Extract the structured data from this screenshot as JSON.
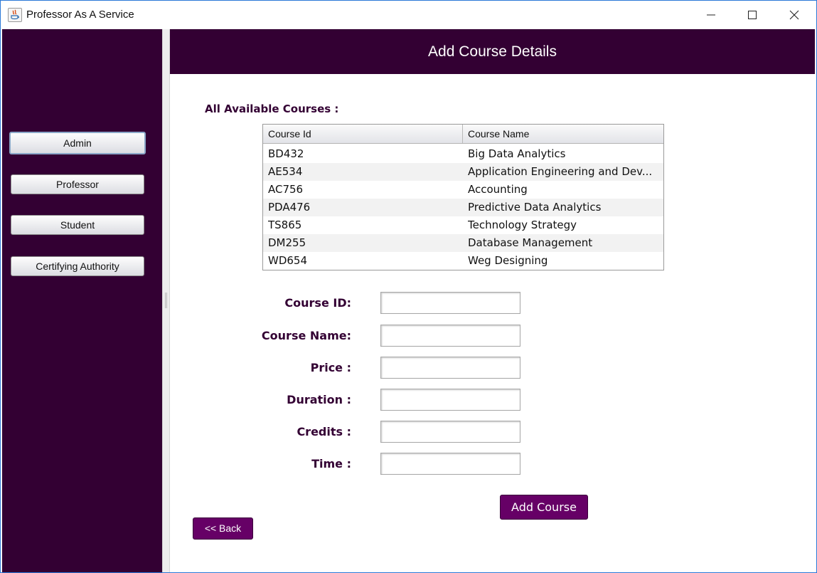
{
  "window": {
    "title": "Professor As A Service",
    "controls": [
      "minimize",
      "maximize",
      "close"
    ]
  },
  "colors": {
    "primary": "#330033",
    "button": "#660066",
    "accent_border": "#2b79d8"
  },
  "sidebar": {
    "items": [
      {
        "label": "Admin",
        "active": true
      },
      {
        "label": "Professor",
        "active": false
      },
      {
        "label": "Student",
        "active": false
      },
      {
        "label": "Certifying Authority",
        "active": false
      }
    ]
  },
  "main": {
    "title": "Add Course Details",
    "courses_label": "All Available Courses :",
    "table": {
      "columns": [
        "Course Id",
        "Course Name"
      ],
      "rows": [
        [
          "BD432",
          "Big Data Analytics"
        ],
        [
          "AE534",
          "Application Engineering and Dev..."
        ],
        [
          "AC756",
          "Accounting"
        ],
        [
          "PDA476",
          "Predictive Data Analytics"
        ],
        [
          "TS865",
          "Technology Strategy"
        ],
        [
          "DM255",
          "Database Management"
        ],
        [
          "WD654",
          "Weg Designing"
        ]
      ]
    },
    "form": {
      "course_id": {
        "label": "Course ID:",
        "value": ""
      },
      "course_name": {
        "label": "Course Name:",
        "value": ""
      },
      "price": {
        "label": "Price :",
        "value": ""
      },
      "duration": {
        "label": "Duration :",
        "value": ""
      },
      "credits": {
        "label": "Credits :",
        "value": ""
      },
      "time": {
        "label": "Time :",
        "value": ""
      }
    },
    "add_button_label": "Add Course",
    "back_button_label": "<< Back"
  }
}
